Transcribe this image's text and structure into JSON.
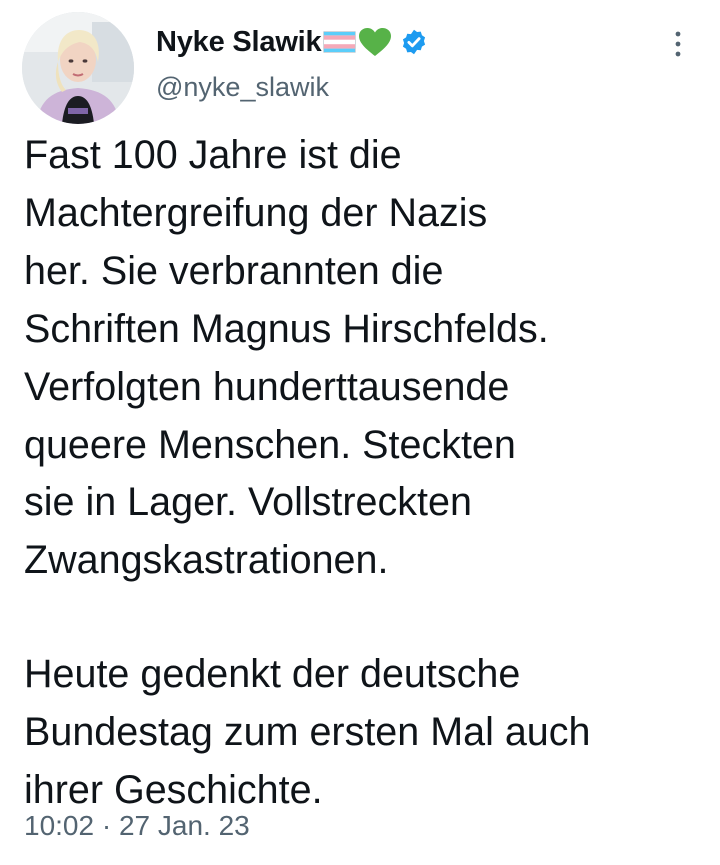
{
  "tweet": {
    "author": {
      "display_name": "Nyke Slawik",
      "handle": "@nyke_slawik",
      "badges": [
        "transgender-flag-emoji",
        "green-heart-emoji",
        "verified-badge"
      ]
    },
    "text_paragraphs": [
      "Fast 100 Jahre ist die\nMachtergreifung der Nazis\nher. Sie verbrannten die\nSchriften Magnus Hirschfelds.\nVerfolgten hunderttausende\nqueere Menschen. Steckten\nsie in Lager. Vollstreckten\nZwangskastrationen.",
      "Heute gedenkt der deutsche\nBundestag zum ersten Mal auch\nihrer Geschichte."
    ],
    "time": "10:02",
    "separator": "·",
    "date": "27 Jan. 23"
  },
  "icons": {
    "more": "more-vertical-icon",
    "verified": "verified-badge-icon"
  },
  "colors": {
    "text": "#0f1419",
    "secondary": "#536471",
    "verified": "#1d9bf0",
    "heart": "#57b248",
    "flag_blue": "#5bcefa",
    "flag_pink": "#f5a9b8",
    "flag_white": "#ffffff"
  }
}
